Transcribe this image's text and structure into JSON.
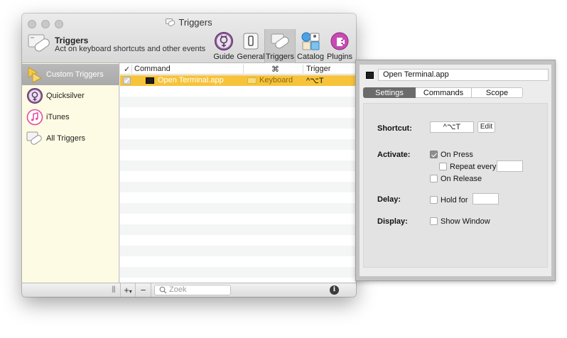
{
  "window": {
    "title": "Triggers"
  },
  "header": {
    "title": "Triggers",
    "subtitle": "Act on keyboard shortcuts and other events"
  },
  "toolbar": {
    "items": [
      {
        "label": "Guide",
        "icon": "quicksilver-icon"
      },
      {
        "label": "General",
        "icon": "switch-icon"
      },
      {
        "label": "Triggers",
        "icon": "triggers-icon",
        "selected": true
      },
      {
        "label": "Catalog",
        "icon": "catalog-icon"
      },
      {
        "label": "Plugins",
        "icon": "plugins-icon"
      }
    ]
  },
  "sidebar": {
    "items": [
      {
        "label": "Custom Triggers",
        "icon": "custom-triggers-icon",
        "selected": true
      },
      {
        "label": "Quicksilver",
        "icon": "quicksilver-icon"
      },
      {
        "label": "iTunes",
        "icon": "itunes-icon"
      },
      {
        "label": "All Triggers",
        "icon": "all-triggers-icon"
      }
    ]
  },
  "table": {
    "headers": {
      "check": "✓",
      "command": "Command",
      "type": "⌘",
      "trigger": "Trigger"
    },
    "rows": [
      {
        "checked": true,
        "command": "Open Terminal.app",
        "type": "Keyboard",
        "trigger": "^⌥T",
        "selected": true
      }
    ]
  },
  "bottombar": {
    "add": "+",
    "add_menu": "▾",
    "remove": "−",
    "search_placeholder": "Zoek",
    "info": "i",
    "resize_handle": "|||"
  },
  "detail": {
    "command_name": "Open Terminal.app",
    "tabs": [
      {
        "label": "Settings",
        "selected": true
      },
      {
        "label": "Commands"
      },
      {
        "label": "Scope"
      }
    ],
    "shortcut_label": "Shortcut:",
    "shortcut_value": "^⌥T",
    "edit_button": "Edit",
    "activate_label": "Activate:",
    "on_press": "On Press",
    "repeat_every": "Repeat every",
    "on_release": "On Release",
    "delay_label": "Delay:",
    "hold_for": "Hold for",
    "display_label": "Display:",
    "show_window": "Show Window"
  },
  "colors": {
    "selection": "#f6c33a",
    "sidebar_bg": "#fdfbe3",
    "tab_selected": "#6b6b6b"
  }
}
